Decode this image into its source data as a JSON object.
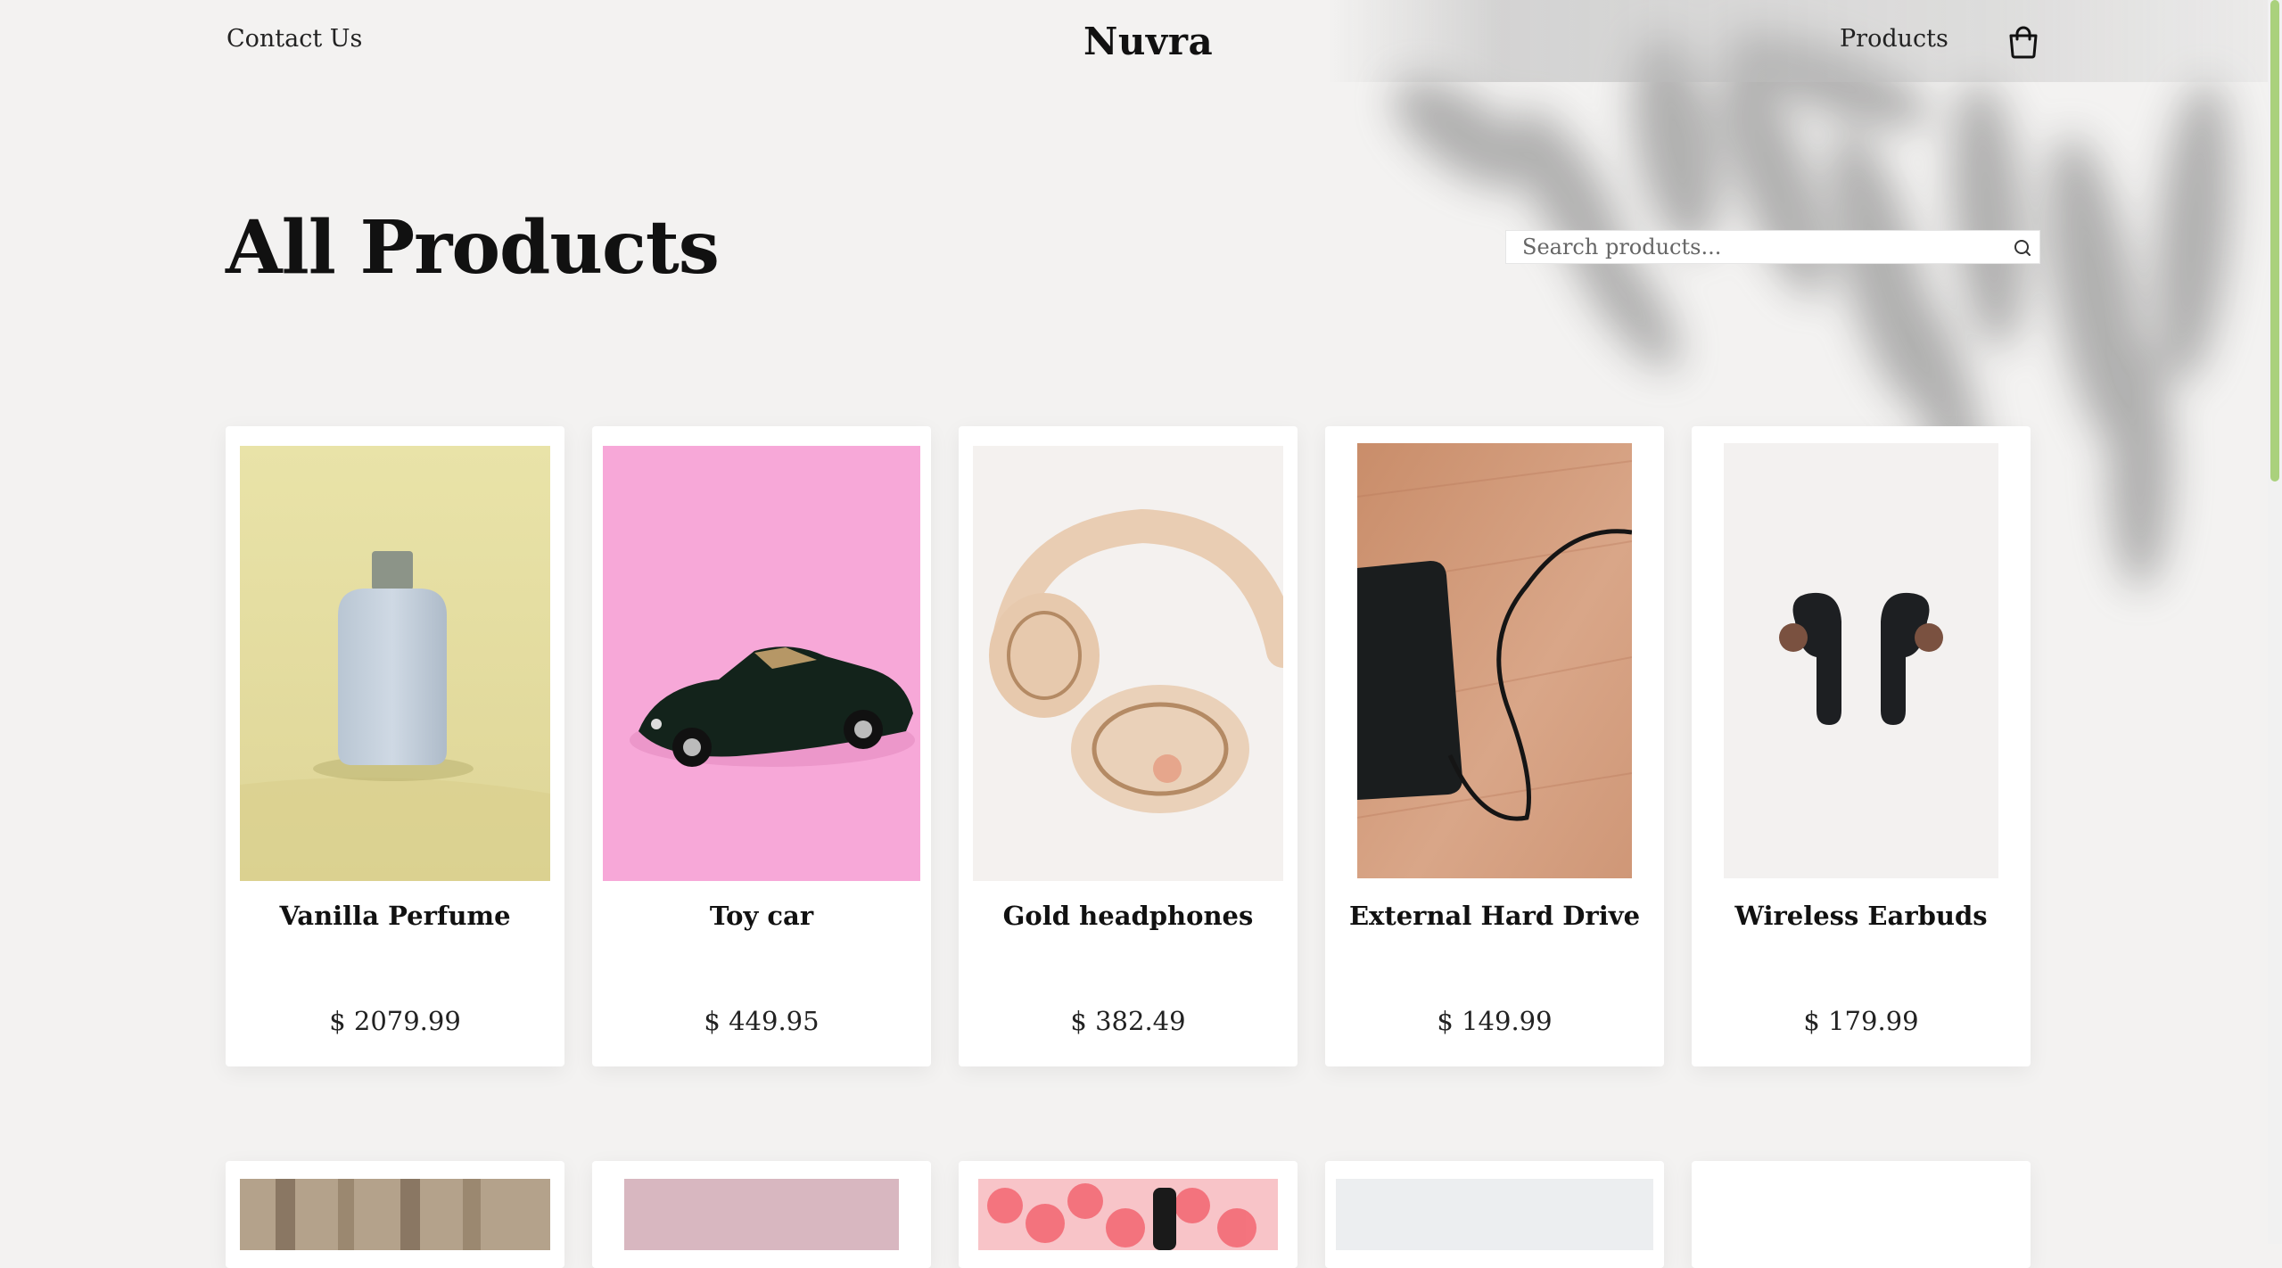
{
  "header": {
    "contact_label": "Contact Us",
    "brand": "Nuvra",
    "products_label": "Products",
    "cart_icon": "shopping-bag-icon"
  },
  "page": {
    "title": "All Products",
    "search_placeholder": "Search products...",
    "search_icon": "search-icon"
  },
  "products": [
    {
      "name": "Vanilla Perfume",
      "price": "$ 2079.99"
    },
    {
      "name": "Toy car",
      "price": "$ 449.95"
    },
    {
      "name": "Gold headphones",
      "price": "$ 382.49"
    },
    {
      "name": "External Hard Drive",
      "price": "$ 149.99"
    },
    {
      "name": "Wireless Earbuds",
      "price": "$ 179.99"
    }
  ],
  "colors": {
    "background": "#f3f2f1",
    "card": "#ffffff",
    "text": "#111111"
  }
}
